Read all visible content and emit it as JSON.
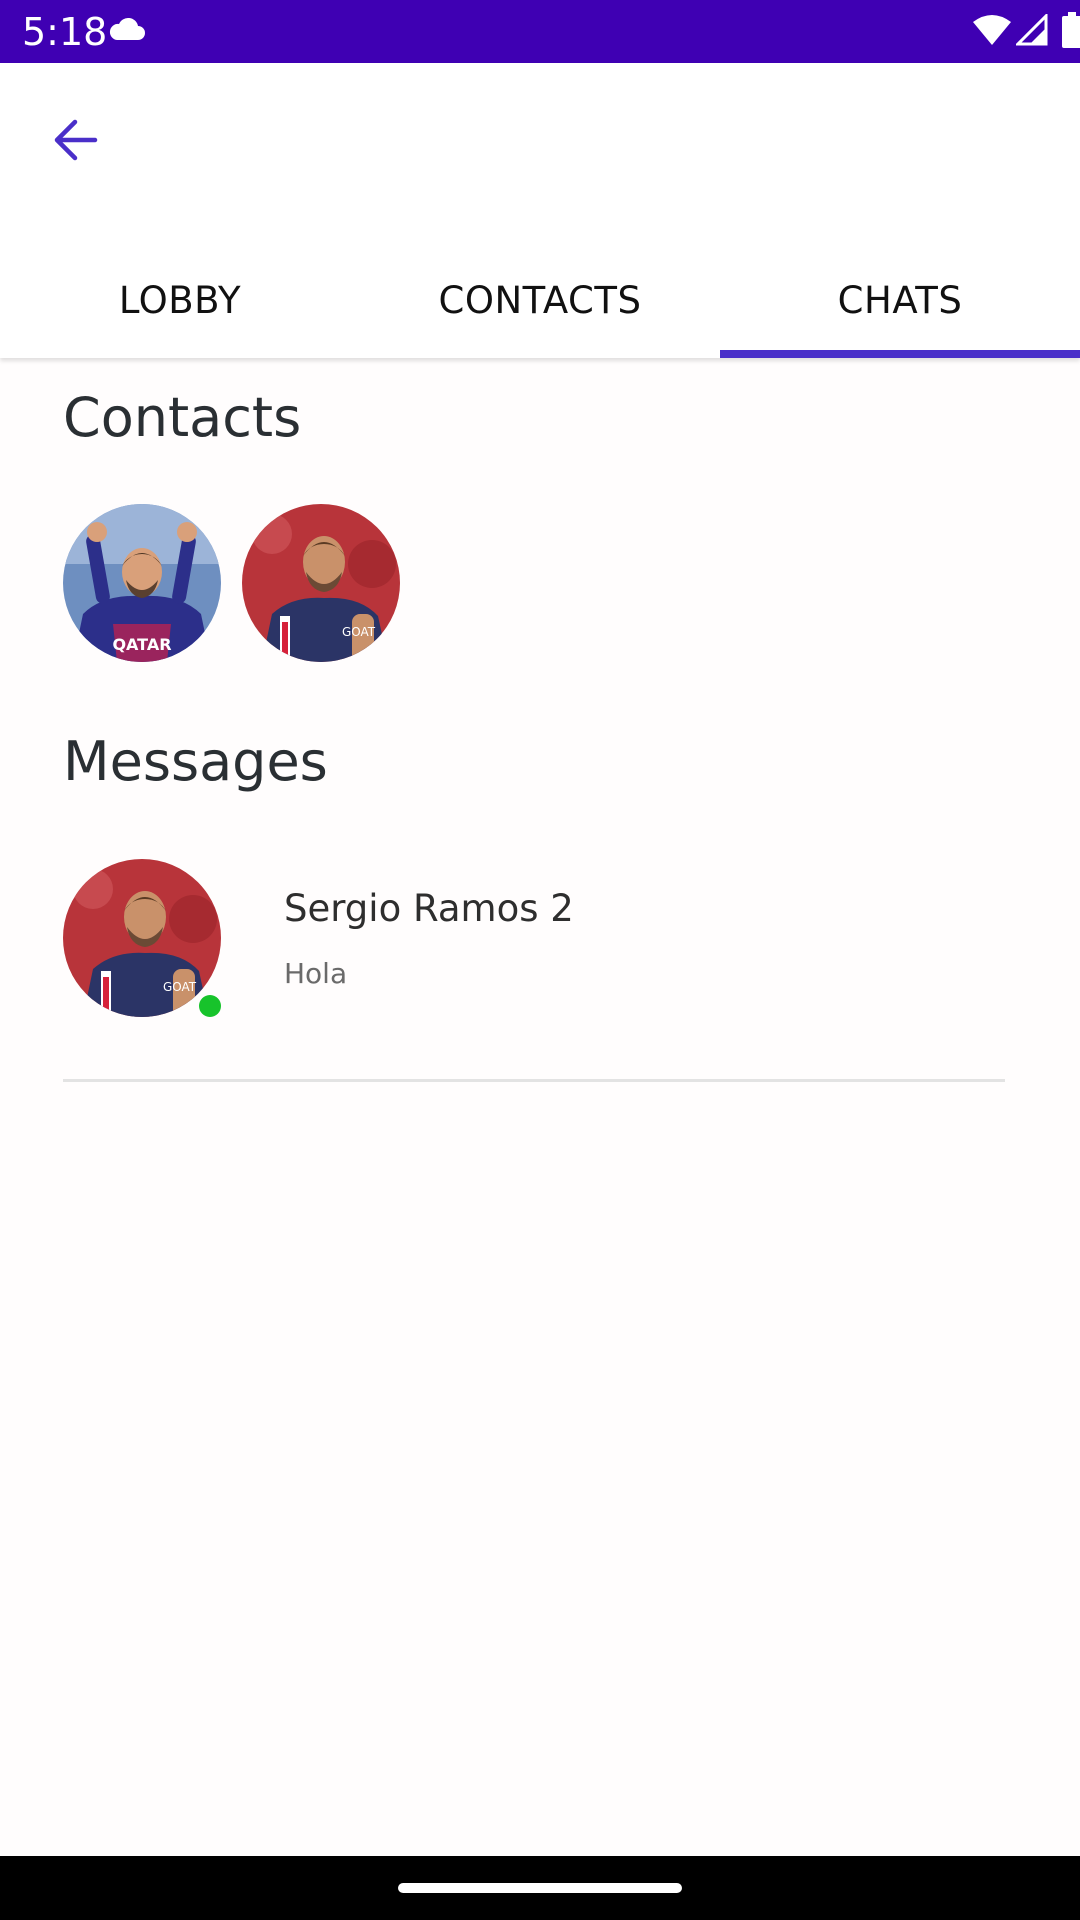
{
  "status_bar": {
    "time": "5:18",
    "icons": [
      "cloud-icon",
      "wifi-icon",
      "signal-icon",
      "battery-icon"
    ],
    "background": "#3f00b3"
  },
  "toolbar": {
    "back_icon": "arrow-left-icon",
    "accent": "#4a2fc9"
  },
  "tabs": [
    {
      "label": "LOBBY",
      "active": false
    },
    {
      "label": "CONTACTS",
      "active": false
    },
    {
      "label": "CHATS",
      "active": true
    }
  ],
  "contacts_section": {
    "title": "Contacts",
    "avatars": [
      "contact-avatar-photo",
      "contact-avatar-photo"
    ]
  },
  "messages_section": {
    "title": "Messages",
    "items": [
      {
        "name": "Sergio Ramos 2",
        "preview": "Hola",
        "online": true,
        "status_color": "#17c32b"
      }
    ]
  }
}
